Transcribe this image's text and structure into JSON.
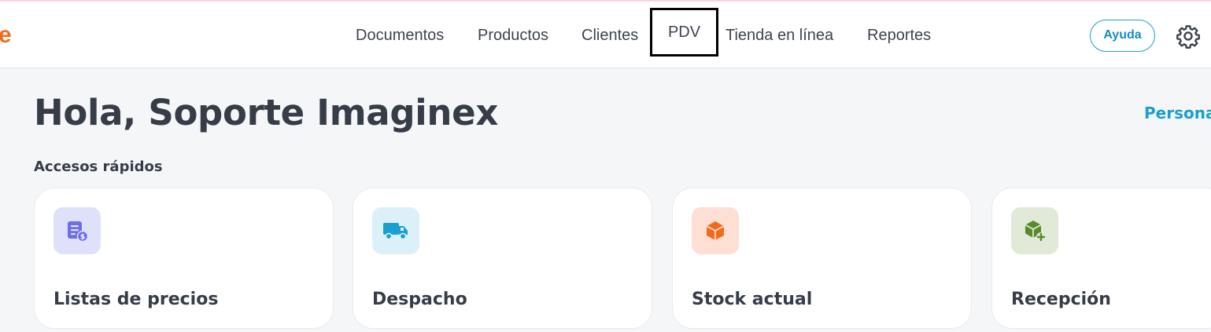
{
  "header": {
    "logo_text": "e",
    "nav": [
      {
        "label": "Documentos"
      },
      {
        "label": "Productos"
      },
      {
        "label": "Clientes"
      },
      {
        "label": "PDV"
      },
      {
        "label": "Tienda en línea"
      },
      {
        "label": "Reportes"
      }
    ],
    "active_nav": "PDV",
    "help_label": "Ayuda",
    "settings_icon": "gear-icon"
  },
  "main": {
    "greeting": "Hola, Soporte Imaginex",
    "personalize_label": "Persona",
    "quick_access_title": "Accesos rápidos",
    "cards": [
      {
        "label": "Listas de precios",
        "icon": "price-list-icon"
      },
      {
        "label": "Despacho",
        "icon": "truck-icon"
      },
      {
        "label": "Stock actual",
        "icon": "box-icon"
      },
      {
        "label": "Recepción",
        "icon": "box-add-icon"
      }
    ]
  },
  "colors": {
    "brand_orange": "#f26b1d",
    "accent_blue": "#1a9fcf",
    "text_dark": "#363d48",
    "background": "#f5f6f8"
  }
}
